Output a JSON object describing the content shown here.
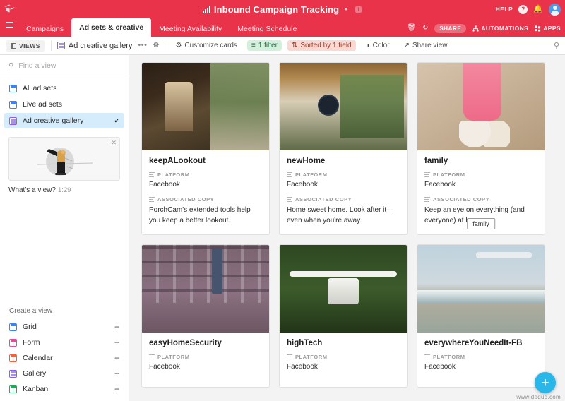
{
  "header": {
    "logo_icon": "airtable-logo-icon",
    "title": "Inbound Campaign Tracking",
    "title_icon": "bar-chart-icon",
    "dropdown_icon": "chevron-down-icon",
    "info_icon": "info-icon",
    "info_glyph": "i",
    "help_label": "HELP",
    "help_icon": "question-circle-icon",
    "help_glyph": "?",
    "notifications_icon": "bell-icon",
    "notifications_glyph": "▲",
    "avatar": "user-avatar",
    "accent_color": "#e8334a"
  },
  "tabs": {
    "menu_icon": "hamburger-menu-icon",
    "items": [
      {
        "label": "Campaigns",
        "active": false
      },
      {
        "label": "Ad sets & creative",
        "active": true
      },
      {
        "label": "Meeting Availability",
        "active": false
      },
      {
        "label": "Meeting Schedule",
        "active": false
      }
    ],
    "right_actions": [
      {
        "label": "",
        "icon": "trash-icon",
        "glyph": "Ὕ1"
      },
      {
        "label": "",
        "icon": "history-icon",
        "glyph": "↺"
      },
      {
        "label": "SHARE",
        "icon": "share-pill"
      },
      {
        "label": "AUTOMATIONS",
        "icon": "automations-icon",
        "glyph": "⑂"
      },
      {
        "label": "APPS",
        "icon": "apps-icon",
        "glyph": "∷"
      }
    ]
  },
  "viewbar": {
    "views_label": "VIEWS",
    "views_icon": "side-panel-icon",
    "current_view": "Ad creative gallery",
    "current_view_icon": "gallery-view-icon",
    "more_icon": "ellipsis-icon",
    "more_glyph": "•••",
    "collaborators_icon": "collaborators-icon",
    "collaborators_glyph": "⚈",
    "buttons": [
      {
        "label": "Customize cards",
        "icon": "gear-icon",
        "glyph": "⚙",
        "style": "plain"
      },
      {
        "label": "1 filter",
        "icon": "filter-icon",
        "glyph": "≡",
        "style": "green"
      },
      {
        "label": "Sorted by 1 field",
        "icon": "sort-icon",
        "glyph": "⇅",
        "style": "red"
      },
      {
        "label": "Color",
        "icon": "color-drop-icon",
        "glyph": "◕",
        "style": "plain"
      },
      {
        "label": "Share view",
        "icon": "share-view-icon",
        "glyph": "↗",
        "style": "plain"
      }
    ],
    "search_icon": "search-icon",
    "search_glyph": "⌕",
    "filter_pill_color": "#d3f0dc",
    "sort_pill_color": "#fbd9d3"
  },
  "sidebar": {
    "search": {
      "placeholder": "Find a view",
      "icon": "search-icon",
      "glyph": "⌕"
    },
    "views": [
      {
        "label": "All ad sets",
        "icon": "grid-view-icon",
        "color": "blue",
        "selected": false,
        "check": ""
      },
      {
        "label": "Live ad sets",
        "icon": "grid-view-icon",
        "color": "blue",
        "selected": false,
        "check": ""
      },
      {
        "label": "Ad creative gallery",
        "icon": "gallery-view-icon",
        "color": "purple",
        "selected": true,
        "check": "✔"
      }
    ],
    "promo": {
      "close_icon": "close-icon",
      "close_glyph": "✕",
      "thumbnail": "video-thumbnail-person-with-binoculars",
      "caption": "What's a view?",
      "duration": "1:29"
    },
    "create": {
      "title": "Create a view",
      "items": [
        {
          "label": "Grid",
          "icon": "grid-view-icon",
          "color": "blue",
          "add_glyph": "+"
        },
        {
          "label": "Form",
          "icon": "form-view-icon",
          "color": "pink",
          "add_glyph": "+"
        },
        {
          "label": "Calendar",
          "icon": "calendar-view-icon",
          "color": "orange",
          "add_glyph": "+"
        },
        {
          "label": "Gallery",
          "icon": "gallery-view-icon",
          "color": "purple",
          "add_glyph": "+"
        },
        {
          "label": "Kanban",
          "icon": "kanban-view-icon",
          "color": "green",
          "add_glyph": "+"
        }
      ]
    }
  },
  "gallery": {
    "field_labels": {
      "platform": "PLATFORM",
      "copy": "ASSOCIATED COPY"
    },
    "cards": [
      {
        "title": "keepALookout",
        "platform": "Facebook",
        "copy": "PorchCam's extended tools help you keep a better lookout.",
        "image": "photo-person-with-telescope-on-porch",
        "image_class": "ph-lookout",
        "show_copy": true,
        "badge": ""
      },
      {
        "title": "newHome",
        "platform": "Facebook",
        "copy": "Home sweet home. Look after it—even when you're away.",
        "image": "photo-covered-porch-with-clock",
        "image_class": "ph-newhome",
        "show_copy": true,
        "badge": ""
      },
      {
        "title": "family",
        "platform": "Facebook",
        "copy": "Keep an eye on everything (and everyone) at home.",
        "image": "photo-child-and-dog-on-couch",
        "image_class": "ph-family",
        "show_copy": true,
        "badge": "family"
      },
      {
        "title": "easyHomeSecurity",
        "platform": "Facebook",
        "copy": "",
        "image": "photo-wall-of-security-cameras",
        "image_class": "ph-security",
        "show_copy": false,
        "badge": ""
      },
      {
        "title": "highTech",
        "platform": "Facebook",
        "copy": "",
        "image": "photo-drone-over-forest",
        "image_class": "ph-hightech",
        "show_copy": false,
        "badge": ""
      },
      {
        "title": "everywhereYouNeedIt-FB",
        "platform": "Facebook",
        "copy": "",
        "image": "photo-drone-over-beach",
        "image_class": "ph-everywhere",
        "show_copy": false,
        "badge": ""
      }
    ],
    "add_button_glyph": "+",
    "add_button_color": "#29b6e8",
    "watermark": "www.deduq.com"
  }
}
